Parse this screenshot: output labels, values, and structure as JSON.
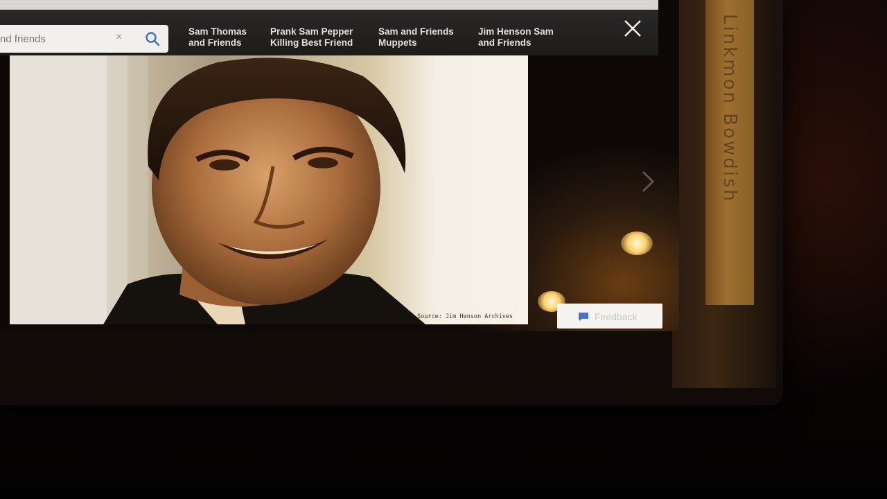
{
  "search": {
    "value": "nd friends",
    "clear_glyph": "×",
    "icon": "search-icon"
  },
  "related_searches": [
    {
      "label": "Sam Thomas and Friends"
    },
    {
      "label": "Prank Sam Pepper Killing Best Friend"
    },
    {
      "label": "Sam and Friends Muppets"
    },
    {
      "label": "Jim Henson Sam and Friends"
    }
  ],
  "close_icon": "close-icon",
  "image_viewer": {
    "source_credit": "Source: Jim Henson Archives",
    "next_icon": "chevron-right-icon"
  },
  "feedback": {
    "label": "Feedback",
    "icon": "speech-bubble-icon"
  },
  "nav_bar": {
    "back_icon": "back-triangle-icon",
    "home_icon": "home-circle-icon",
    "recents_icon": "recents-square-icon"
  },
  "device_label": "Linkmon Bowdish",
  "colors": {
    "topbar": "#1e1c1b",
    "chip_text": "#e4dfd8",
    "feedback_icon": "#4a6fd4",
    "screen_glow": "#ffd26a"
  }
}
